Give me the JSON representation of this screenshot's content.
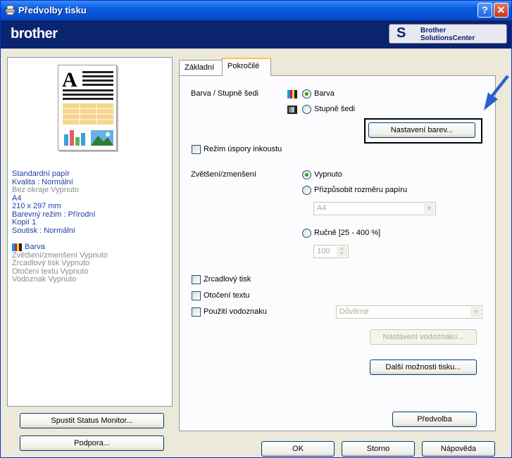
{
  "window": {
    "title": "Předvolby tisku",
    "help_glyph": "?",
    "close_glyph": "✕"
  },
  "brand": {
    "logo": "brother",
    "solutions_line1": "Brother",
    "solutions_line2": "SolutionsCenter"
  },
  "summary": {
    "lines": [
      "Standardní papír",
      "Kvalita : Normální",
      "Bez okraje Vypnuto",
      "A4",
      "210 x 297 mm",
      "Barevný režim : Přírodní",
      "Kopií 1",
      "Soutisk : Normální"
    ],
    "color_mode": "Barva",
    "extra_lines": [
      "Zvětšení/zmenšení Vypnuto",
      "Zrcadlový tisk Vypnuto",
      "Otočení textu Vypnuto",
      "Vodoznak Vypnuto"
    ]
  },
  "left_buttons": {
    "status_monitor": "Spustit Status Monitor...",
    "support": "Podpora..."
  },
  "tabs": [
    {
      "label": "Základní"
    },
    {
      "label": "Pokročilé"
    }
  ],
  "advanced": {
    "color_label": "Barva / Stupně šedi",
    "color_option": "Barva",
    "gray_option": "Stupně šedi",
    "color_settings_button": "Nastavení barev...",
    "ink_save": "Režim úspory inkoustu",
    "scaling_label": "Zvětšení/zmenšení",
    "scaling_off": "Vypnuto",
    "scaling_fit": "Přizpůsobit rozměru papíru",
    "paper_size_value": "A4",
    "scaling_manual": "Ručně [25 - 400 %]",
    "manual_value": "100",
    "mirror_print": "Zrcadlový tisk",
    "rotate_text": "Otočení textu",
    "use_watermark": "Použití vodoznaku",
    "watermark_value": "Důvěrné",
    "watermark_settings_button": "Nastavení vodoznaku...",
    "more_options_button": "Další možnosti tisku...",
    "default_button": "Předvolba"
  },
  "dialog_buttons": {
    "ok": "OK",
    "cancel": "Storno",
    "help": "Nápověda"
  },
  "colors": {
    "title_blue": "#0a5ce2",
    "brand_navy": "#0a2470",
    "summary_blue": "#1f3da8",
    "arrow_blue": "#2a5fd0"
  }
}
